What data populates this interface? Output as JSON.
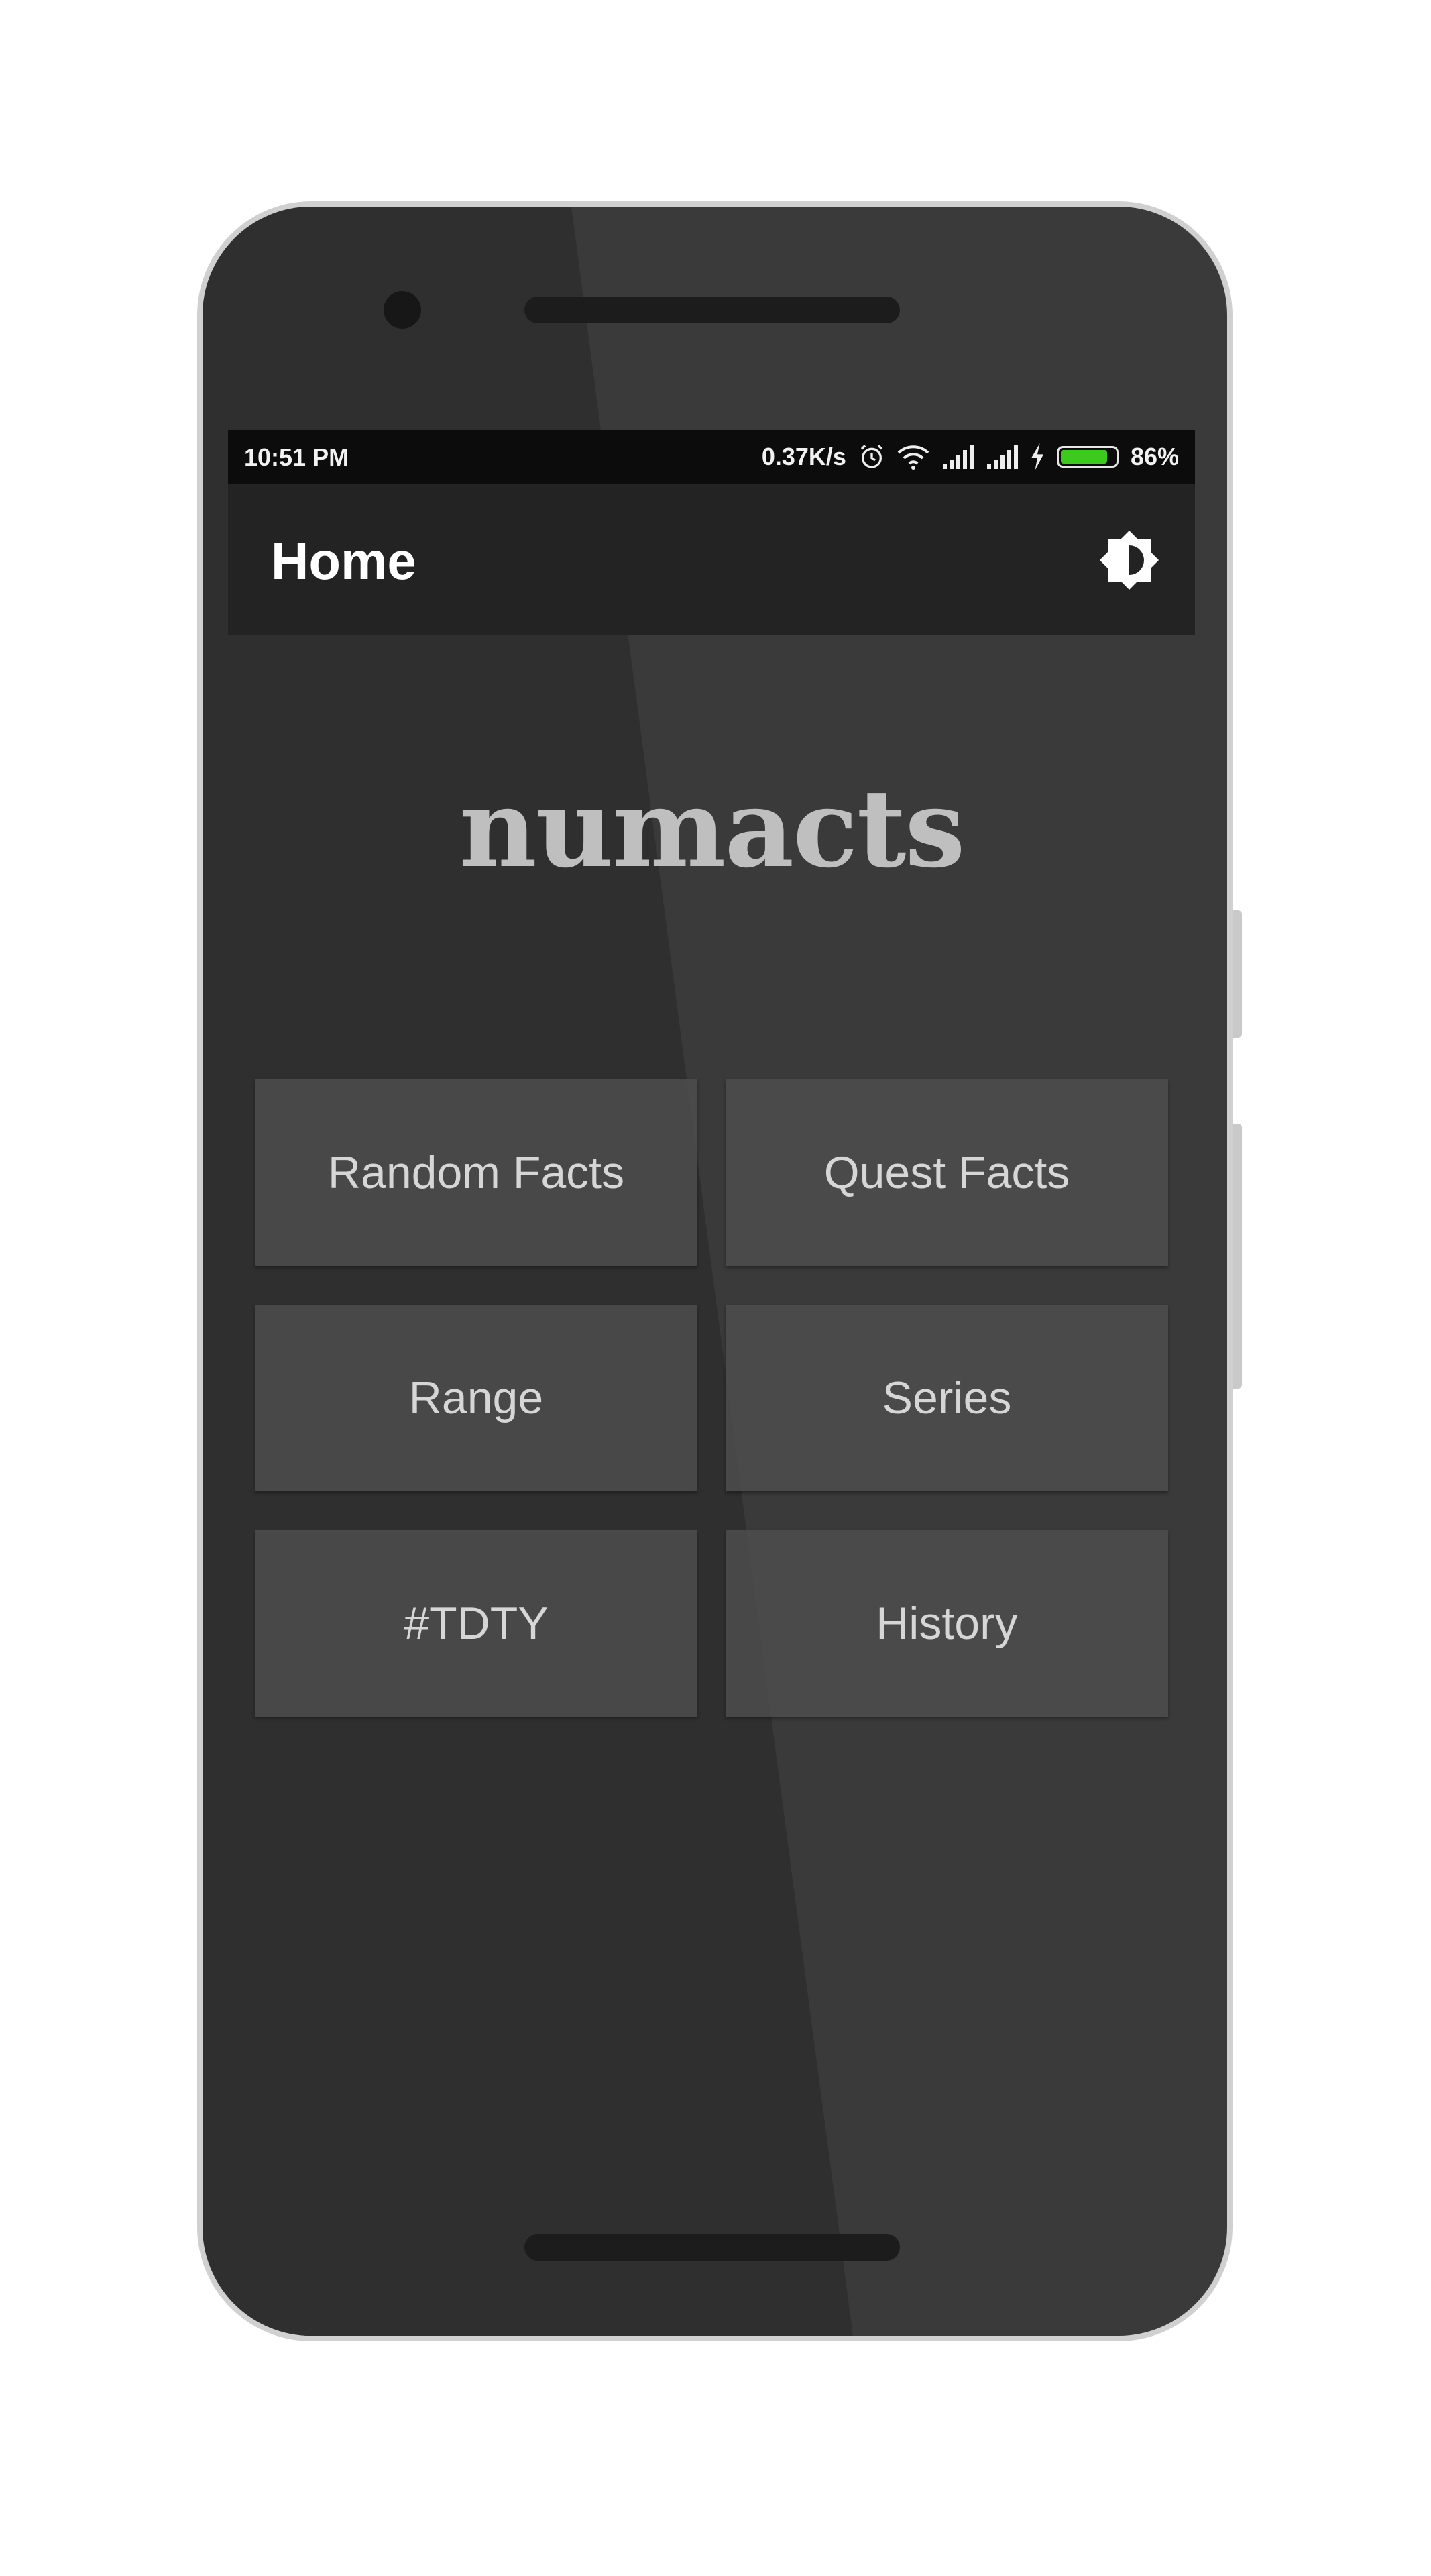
{
  "status_bar": {
    "time": "10:51 PM",
    "net_speed": "0.37K/s",
    "battery_percent": "86%",
    "battery_level": 0.86,
    "icons": [
      "alarm-icon",
      "wifi-icon",
      "signal-icon",
      "signal-icon",
      "charging-icon",
      "battery-icon"
    ]
  },
  "app_bar": {
    "title": "Home",
    "action_icon": "brightness-icon"
  },
  "logo": {
    "text": "numacts"
  },
  "menu": {
    "items": [
      {
        "label": "Random Facts"
      },
      {
        "label": "Quest Facts"
      },
      {
        "label": "Range"
      },
      {
        "label": "Series"
      },
      {
        "label": "#TDTY"
      },
      {
        "label": "History"
      }
    ]
  },
  "colors": {
    "background": "#3a3a3a",
    "app_bar": "#232323",
    "status_bar": "#0c0c0c",
    "tile": "#4a4a4a",
    "battery": "#3ccb1d"
  }
}
